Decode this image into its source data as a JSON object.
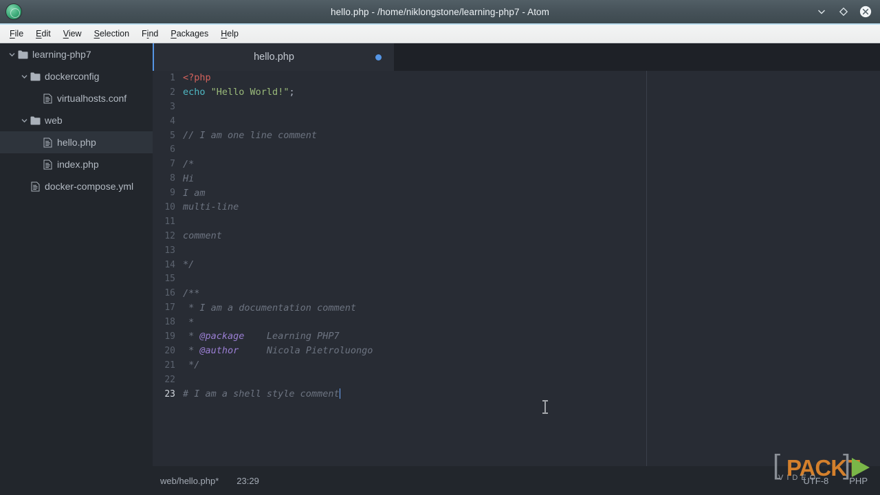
{
  "window": {
    "title": "hello.php - /home/niklongstone/learning-php7 - Atom",
    "app_icon": "atom-icon",
    "controls": [
      {
        "name": "minimize-button",
        "icon": "chevron-down-icon"
      },
      {
        "name": "maximize-button",
        "icon": "diamond-icon"
      },
      {
        "name": "close-button",
        "icon": "close-circle-icon"
      }
    ]
  },
  "menubar": {
    "items": [
      {
        "label": "File",
        "mnemonic": "F",
        "rest": "ile"
      },
      {
        "label": "Edit",
        "mnemonic": "E",
        "rest": "dit"
      },
      {
        "label": "View",
        "mnemonic": "V",
        "rest": "iew"
      },
      {
        "label": "Selection",
        "mnemonic": "S",
        "rest": "election"
      },
      {
        "label": "Find",
        "mnemonic": "Fi",
        "rest": "nd"
      },
      {
        "label": "Packages",
        "mnemonic": "P",
        "rest": "ackages"
      },
      {
        "label": "Help",
        "mnemonic": "H",
        "rest": "elp"
      }
    ]
  },
  "sidebar": {
    "items": [
      {
        "label": "learning-php7",
        "depth": 1,
        "type": "folder",
        "expanded": true,
        "selected": false
      },
      {
        "label": "dockerconfig",
        "depth": 2,
        "type": "folder",
        "expanded": true,
        "selected": false
      },
      {
        "label": "virtualhosts.conf",
        "depth": 3,
        "type": "file",
        "expanded": false,
        "selected": false
      },
      {
        "label": "web",
        "depth": 2,
        "type": "folder",
        "expanded": true,
        "selected": false
      },
      {
        "label": "hello.php",
        "depth": 3,
        "type": "file",
        "expanded": false,
        "selected": true
      },
      {
        "label": "index.php",
        "depth": 3,
        "type": "file",
        "expanded": false,
        "selected": false
      },
      {
        "label": "docker-compose.yml",
        "depth": 2,
        "type": "file",
        "expanded": false,
        "selected": false
      }
    ]
  },
  "editor": {
    "tab": {
      "title": "hello.php",
      "modified": true
    },
    "lines": [
      {
        "n": "1",
        "tokens": [
          {
            "t": "<?php",
            "c": "tok-php"
          }
        ]
      },
      {
        "n": "2",
        "tokens": [
          {
            "t": "echo",
            "c": "tok-kw"
          },
          {
            "t": " ",
            "c": "src"
          },
          {
            "t": "\"Hello World!\"",
            "c": "tok-str"
          },
          {
            "t": ";",
            "c": "tok-punc"
          }
        ]
      },
      {
        "n": "3",
        "tokens": []
      },
      {
        "n": "4",
        "tokens": []
      },
      {
        "n": "5",
        "tokens": [
          {
            "t": "// I am one line comment",
            "c": "tok-cmt"
          }
        ]
      },
      {
        "n": "6",
        "tokens": []
      },
      {
        "n": "7",
        "tokens": [
          {
            "t": "/*",
            "c": "tok-cmt"
          }
        ]
      },
      {
        "n": "8",
        "tokens": [
          {
            "t": "Hi",
            "c": "tok-cmt"
          }
        ]
      },
      {
        "n": "9",
        "tokens": [
          {
            "t": "I am",
            "c": "tok-cmt"
          }
        ]
      },
      {
        "n": "10",
        "tokens": [
          {
            "t": "multi-line",
            "c": "tok-cmt"
          }
        ]
      },
      {
        "n": "11",
        "tokens": []
      },
      {
        "n": "12",
        "tokens": [
          {
            "t": "comment",
            "c": "tok-cmt"
          }
        ]
      },
      {
        "n": "13",
        "tokens": []
      },
      {
        "n": "14",
        "tokens": [
          {
            "t": "*/",
            "c": "tok-cmt"
          }
        ]
      },
      {
        "n": "15",
        "tokens": []
      },
      {
        "n": "16",
        "tokens": [
          {
            "t": "/**",
            "c": "tok-cmt"
          }
        ]
      },
      {
        "n": "17",
        "tokens": [
          {
            "t": " * I am a documentation comment",
            "c": "tok-cmt"
          }
        ]
      },
      {
        "n": "18",
        "tokens": [
          {
            "t": " *",
            "c": "tok-cmt"
          }
        ]
      },
      {
        "n": "19",
        "tokens": [
          {
            "t": " * ",
            "c": "tok-cmt"
          },
          {
            "t": "@package",
            "c": "tok-tag"
          },
          {
            "t": "    Learning PHP7",
            "c": "tok-cmt"
          }
        ]
      },
      {
        "n": "20",
        "tokens": [
          {
            "t": " * ",
            "c": "tok-cmt"
          },
          {
            "t": "@author",
            "c": "tok-tag"
          },
          {
            "t": "     Nicola Pietroluongo",
            "c": "tok-cmt"
          }
        ]
      },
      {
        "n": "21",
        "tokens": [
          {
            "t": " */",
            "c": "tok-cmt"
          }
        ]
      },
      {
        "n": "22",
        "tokens": []
      },
      {
        "n": "23",
        "tokens": [
          {
            "t": "# I am a shell style comment",
            "c": "tok-cmt"
          }
        ],
        "active": true,
        "caret": true
      }
    ]
  },
  "statusbar": {
    "file_path": "web/hello.php*",
    "cursor_position": "23:29",
    "encoding": "UTF-8",
    "grammar": "PHP"
  },
  "watermark": {
    "bracket_open": "[",
    "bracket_close": "]",
    "brand": "PACKT",
    "subtitle": "VIDEO"
  },
  "colors": {
    "accent_blue": "#5596e6",
    "titlebar_underline": "#b9dcef",
    "editor_bg": "#282c34",
    "sidebar_bg": "#22262c",
    "packt_orange": "#d4802c",
    "packt_green": "#7ab648"
  }
}
